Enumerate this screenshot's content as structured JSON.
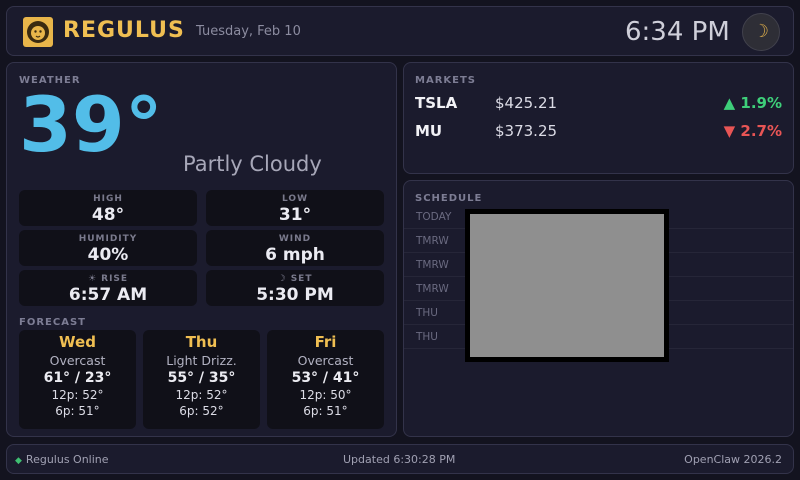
{
  "header": {
    "app_title": "REGULUS",
    "date": "Tuesday, Feb 10",
    "time": "6:34 PM",
    "theme_icon": "☽"
  },
  "weather": {
    "section_label": "WEATHER",
    "temperature": "39°",
    "condition": "Partly Cloudy",
    "stats": {
      "high": {
        "label": "HIGH",
        "value": "48°"
      },
      "low": {
        "label": "LOW",
        "value": "31°"
      },
      "humidity": {
        "label": "HUMIDITY",
        "value": "40%"
      },
      "wind": {
        "label": "WIND",
        "value": "6 mph"
      },
      "rise": {
        "label": "☀ RISE",
        "value": "6:57 AM"
      },
      "set": {
        "label": "☽ SET",
        "value": "5:30 PM"
      }
    },
    "forecast_label": "FORECAST",
    "forecast": [
      {
        "day": "Wed",
        "condition": "Overcast",
        "range": "61° / 23°",
        "noon": "12p: 52°",
        "evening": "6p: 51°"
      },
      {
        "day": "Thu",
        "condition": "Light Drizz.",
        "range": "55° / 35°",
        "noon": "12p: 52°",
        "evening": "6p: 52°"
      },
      {
        "day": "Fri",
        "condition": "Overcast",
        "range": "53° / 41°",
        "noon": "12p: 50°",
        "evening": "6p: 51°"
      }
    ]
  },
  "markets": {
    "section_label": "MARKETS",
    "tickers": [
      {
        "symbol": "TSLA",
        "price": "$425.21",
        "change": "▲ 1.9%",
        "direction": "up"
      },
      {
        "symbol": "MU",
        "price": "$373.25",
        "change": "▼ 2.7%",
        "direction": "down"
      }
    ]
  },
  "schedule": {
    "section_label": "SCHEDULE",
    "rows": [
      "TODAY",
      "TMRW",
      "TMRW",
      "TMRW",
      "THU",
      "THU"
    ]
  },
  "footer": {
    "status": "Regulus Online",
    "updated": "Updated 6:30:28 PM",
    "version": "OpenClaw 2026.2"
  },
  "colors": {
    "accent_gold": "#f0bf52",
    "temp_blue": "#52bde8",
    "up_green": "#3ecf7a",
    "down_red": "#e85555",
    "status_green": "#3fbf72"
  }
}
